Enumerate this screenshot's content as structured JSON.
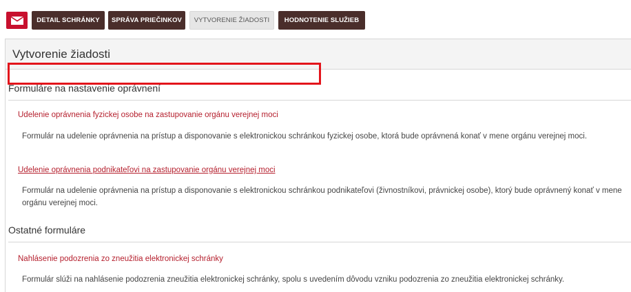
{
  "tabs": [
    {
      "label": "DETAIL SCHRÁNKY"
    },
    {
      "label": "SPRÁVA PRIEČINKOV"
    },
    {
      "label": "VYTVORENIE ŽIADOSTI"
    },
    {
      "label": "HODNOTENIE SLUŽIEB"
    }
  ],
  "page": {
    "title": "Vytvorenie žiadosti"
  },
  "sections": [
    {
      "title": "Formuláre na nastavenie oprávnení",
      "items": [
        {
          "link": "Udelenie oprávnenia fyzickej osobe na zastupovanie orgánu verejnej moci",
          "description": "Formulár na udelenie oprávnenia na prístup a disponovanie s elektronickou schránkou fyzickej osobe, ktorá bude oprávnená konať v mene orgánu verejnej moci."
        },
        {
          "link": "Udelenie oprávnenia podnikateľovi na zastupovanie orgánu verejnej moci",
          "description": "Formulár na udelenie oprávnenia na prístup a disponovanie s elektronickou schránkou podnikateľovi (živnostníkovi, právnickej osobe), ktorý bude oprávnený konať v mene orgánu verejnej moci."
        }
      ]
    },
    {
      "title": "Ostatné formuláre",
      "items": [
        {
          "link": "Nahlásenie podozrenia zo zneužitia elektronickej schránky",
          "description": "Formulár slúži na nahlásenie podozrenia zneužitia elektronickej schránky, spolu s uvedením dôvodu vzniku podozrenia zo zneužitia elektronickej schránky."
        }
      ]
    }
  ],
  "colors": {
    "brand": "#c8102e",
    "tab_dark": "#4a2e2b",
    "link": "#b5202e",
    "highlight": "#e3141b"
  },
  "icons": {
    "logo": "mail-envelope-icon"
  }
}
